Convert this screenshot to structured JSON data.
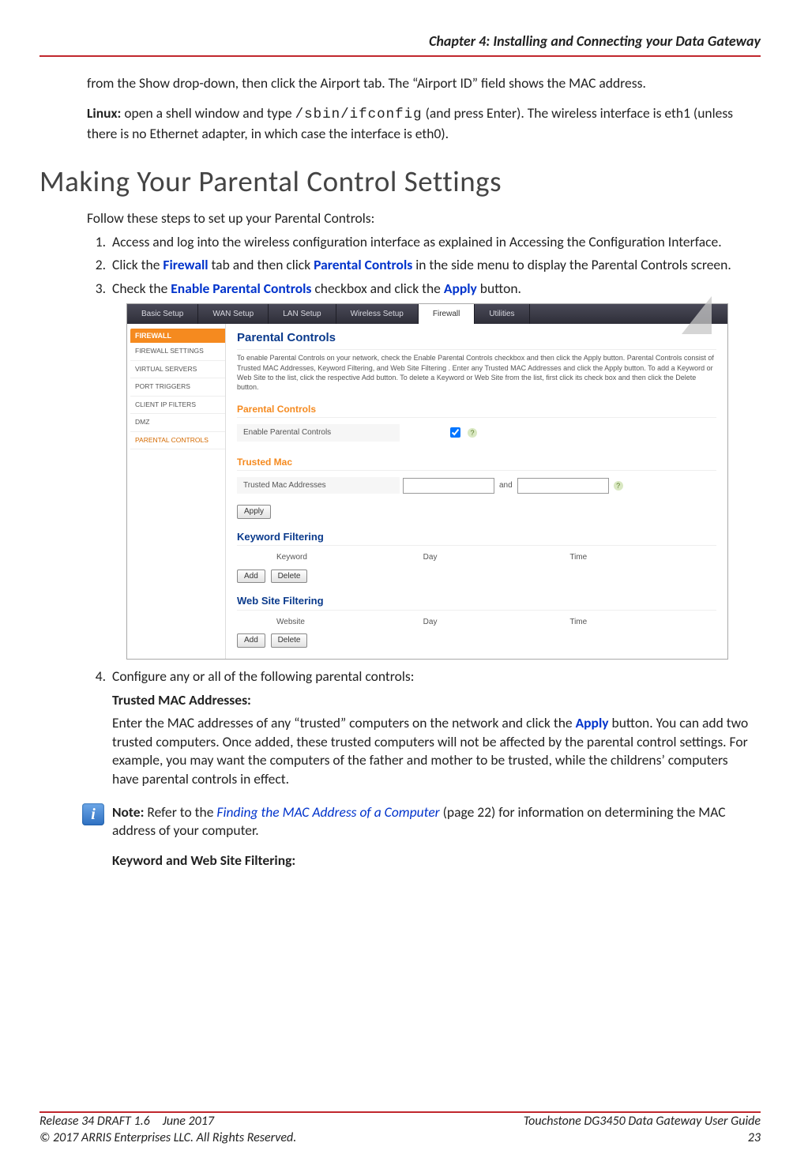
{
  "header": {
    "chapter_title": "Chapter 4: Installing and Connecting your Data Gateway"
  },
  "intro": {
    "mac_para_prefix": "from the Show drop-down, then click the Airport tab. The “Airport ID” field shows the MAC address.",
    "linux_label": "Linux:",
    "linux_text_1": " open a shell window and type ",
    "linux_cmd": "/sbin/ifconfig",
    "linux_text_2": " (and press Enter). The wireless interface is eth1 (unless there is no Ethernet adapter, in which case the interface is eth0)."
  },
  "h1": "Making Your Parental Control Settings",
  "lead": "Follow these steps to set up your Parental Controls:",
  "steps": {
    "s1": "Access and log into the wireless configuration interface as explained in Accessing the Configuration Interface.",
    "s2_a": "Click the ",
    "s2_link1": "Firewall",
    "s2_b": " tab and then click ",
    "s2_link2": "Parental Controls",
    "s2_c": " in the side menu to display the Parental Controls screen.",
    "s3_a": "Check the ",
    "s3_link1": "Enable Parental Controls",
    "s3_b": " checkbox and click the ",
    "s3_link2": "Apply",
    "s3_c": " button.",
    "s4": "Configure any or all of the following parental controls:",
    "s4_h": "Trusted MAC Addresses:",
    "s4_p_a": "Enter the MAC addresses of any “trusted” computers on the network and click the ",
    "s4_p_link": "Apply",
    "s4_p_b": " button. You can add two trusted computers. Once added, these trusted computers will not be affected by the parental control settings. For example, you may want the computers of the father and mother to be trusted, while the childrens’ computers have parental controls in effect.",
    "kw_h": "Keyword and Web Site Filtering:"
  },
  "note": {
    "label": "Note:",
    "text_a": " Refer to the ",
    "link": "Finding the MAC Address of a Computer",
    "text_b": " (page 22) for information on determining the MAC address of your computer."
  },
  "mock": {
    "tabs": [
      "Basic Setup",
      "WAN Setup",
      "LAN Setup",
      "Wireless Setup",
      "Firewall",
      "Utilities"
    ],
    "side_header": "FIREWALL",
    "side_items": [
      "FIREWALL SETTINGS",
      "VIRTUAL SERVERS",
      "PORT TRIGGERS",
      "CLIENT IP FILTERS",
      "DMZ",
      "PARENTAL CONTROLS"
    ],
    "title": "Parental Controls",
    "desc": "To enable Parental Controls on your network, check the Enable Parental Controls checkbox and then click the Apply button. Parental Controls consist of Trusted MAC Addresses, Keyword Filtering, and Web Site Filtering . Enter any Trusted MAC Addresses and click the Apply button. To add a Keyword or Web Site to the list, click the respective Add button. To delete a Keyword or Web Site from the list, first click its check box and then click the Delete button.",
    "sec_pc": "Parental Controls",
    "row_enable": "Enable Parental Controls",
    "sec_tm": "Trusted Mac",
    "row_tm": "Trusted Mac Addresses",
    "and": "and",
    "btn_apply": "Apply",
    "sec_kw": "Keyword Filtering",
    "cols_kw": [
      "Keyword",
      "Day",
      "Time"
    ],
    "btn_add": "Add",
    "btn_del": "Delete",
    "sec_ws": "Web Site Filtering",
    "cols_ws": [
      "Website",
      "Day",
      "Time"
    ]
  },
  "footer": {
    "left1": "Release 34 DRAFT 1.6 June 2017",
    "right1": "Touchstone DG3450 Data Gateway User Guide",
    "left2": "© 2017 ARRIS Enterprises LLC. All Rights Reserved.",
    "right2": "23"
  }
}
